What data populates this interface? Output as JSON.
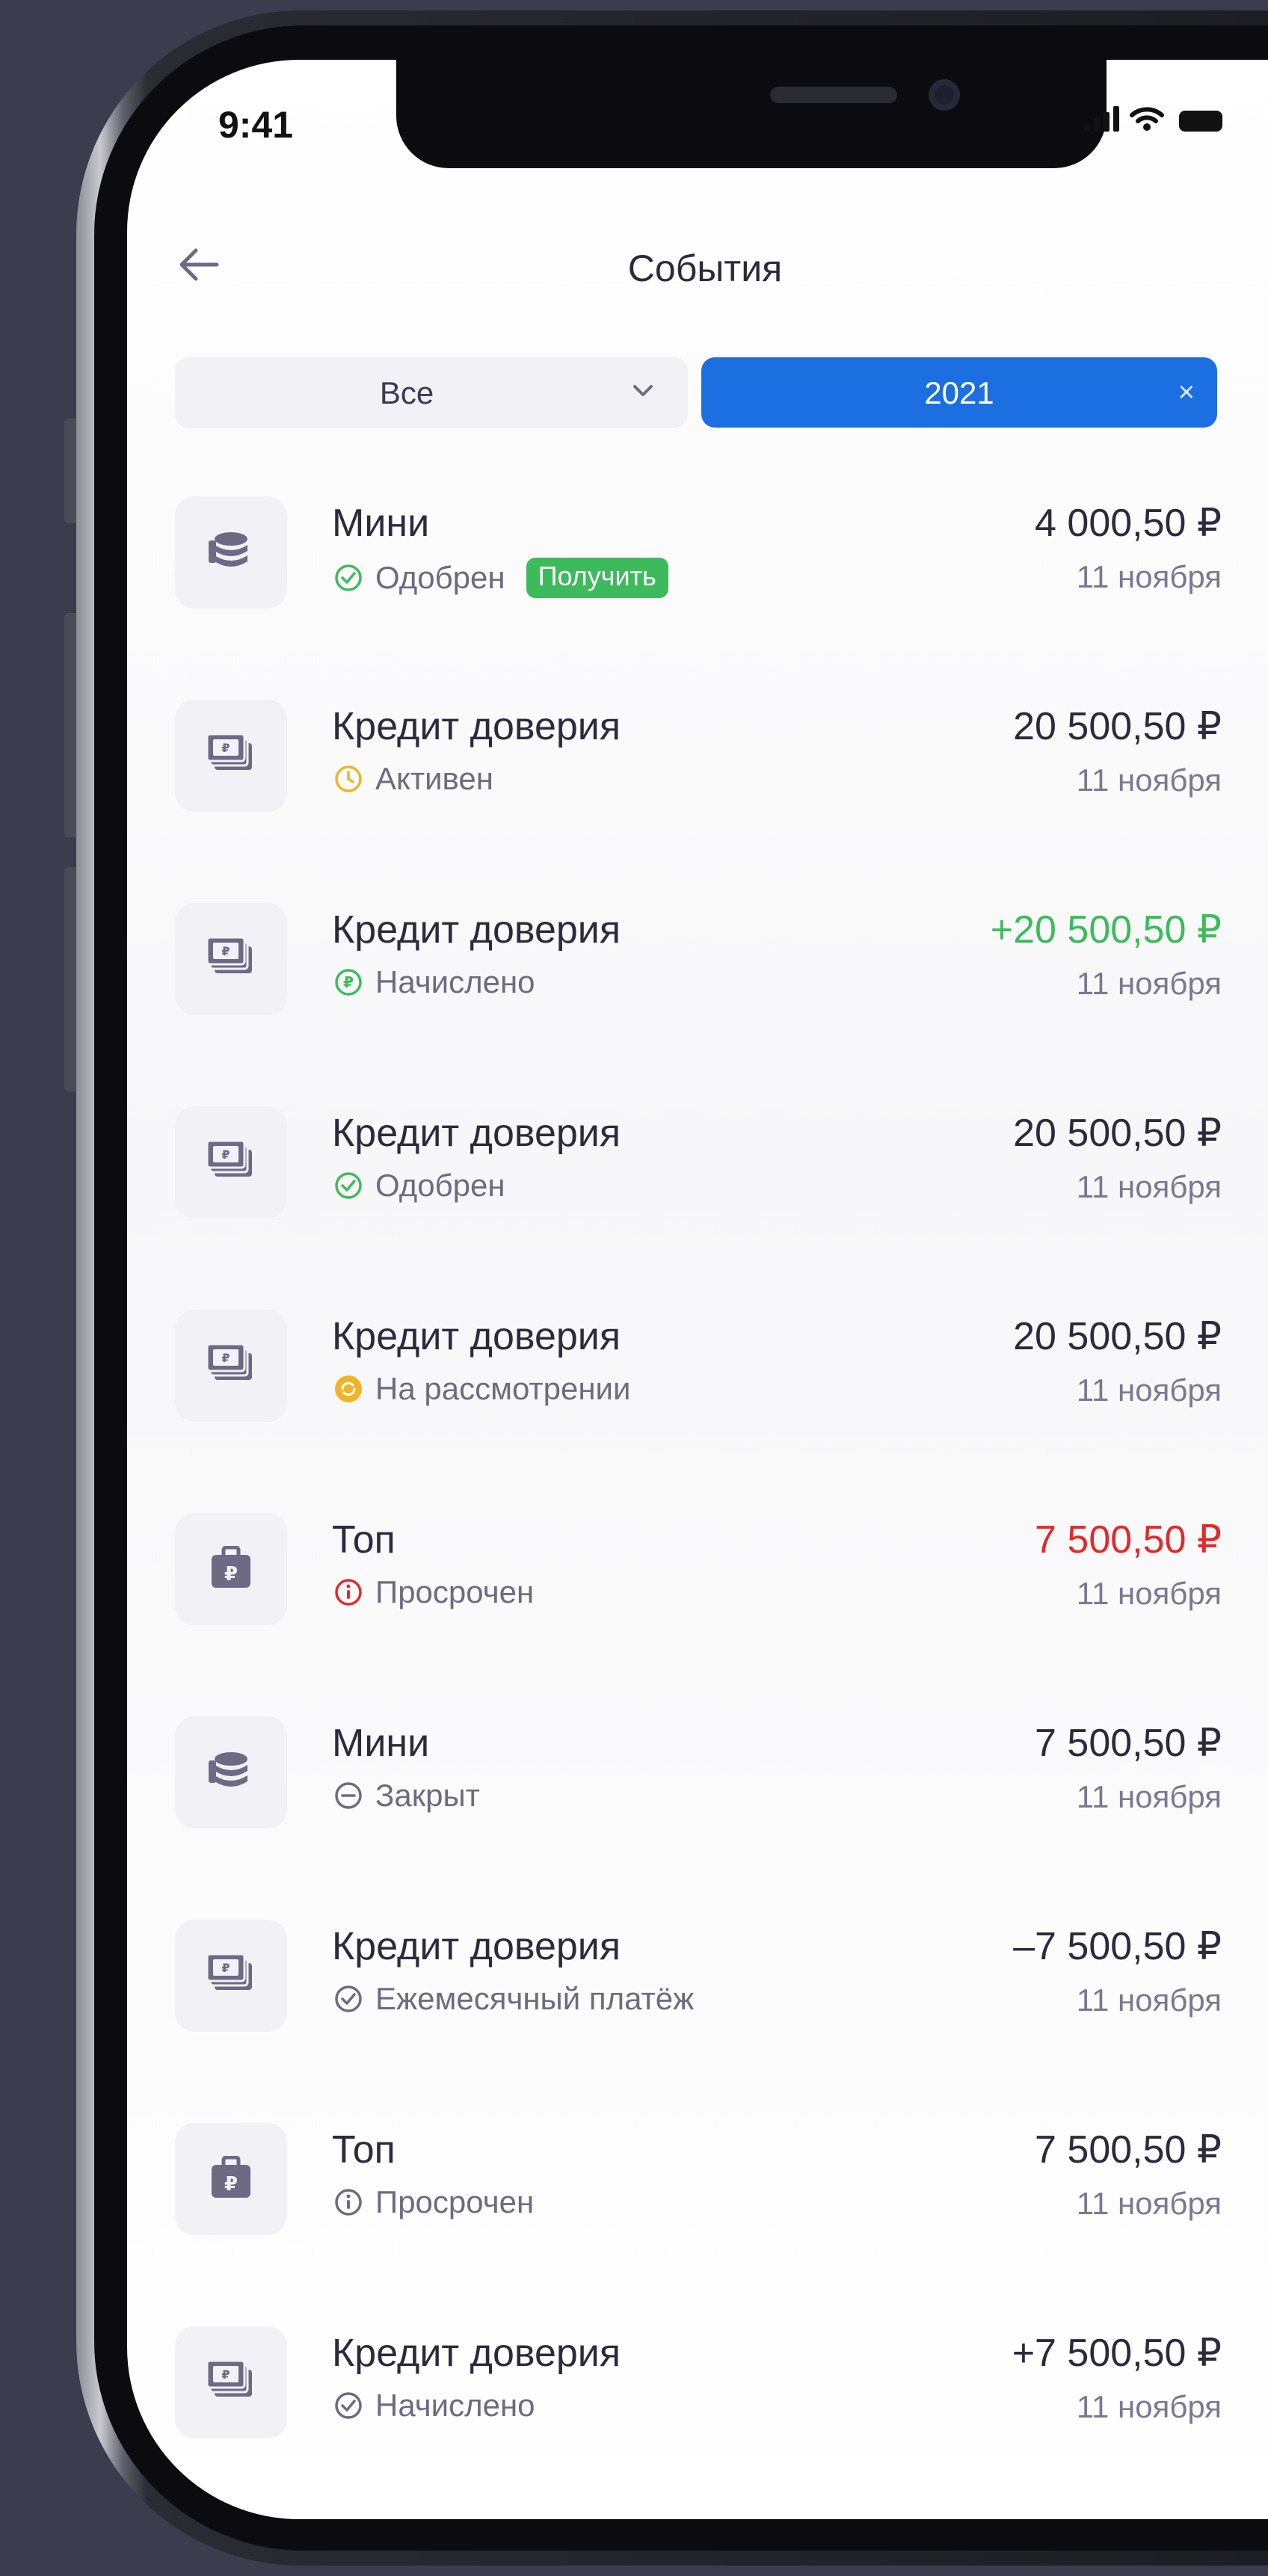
{
  "status_bar": {
    "time": "9:41"
  },
  "header": {
    "title": "События"
  },
  "filters": {
    "type_value": "Все",
    "year_value": "2021",
    "clear_glyph": "×"
  },
  "colors": {
    "accent": "#1c6fe0",
    "positive": "#3dbb5c",
    "negative": "#e02b2b",
    "text": "#2e2a3d",
    "muted": "#6f6a80",
    "icon_bg": "#f1f1f6",
    "icon_fg": "#6e6a85",
    "pending": "#f0b429"
  },
  "events": [
    {
      "icon": "coins-icon",
      "title": "Мини",
      "status": "Одобрен",
      "status_icon": "check-circle-icon",
      "status_color": "#3dbb5c",
      "badge": "Получить",
      "amount": "4 000,50 ₽",
      "amount_color": "#2e2a3d",
      "date": "11 ноября"
    },
    {
      "icon": "banknote-icon",
      "title": "Кредит доверия",
      "status": "Активен",
      "status_icon": "clock-icon",
      "status_color": "#f0b429",
      "badge": "",
      "amount": "20 500,50 ₽",
      "amount_color": "#2e2a3d",
      "date": "11 ноября"
    },
    {
      "icon": "banknote-icon",
      "title": "Кредит доверия",
      "status": "Начислено",
      "status_icon": "ruble-circle-icon",
      "status_color": "#3dbb5c",
      "badge": "",
      "amount": "+20 500,50 ₽",
      "amount_color": "#3dbb5c",
      "date": "11 ноября"
    },
    {
      "icon": "banknote-icon",
      "title": "Кредит доверия",
      "status": "Одобрен",
      "status_icon": "check-circle-icon",
      "status_color": "#3dbb5c",
      "badge": "",
      "amount": "20 500,50 ₽",
      "amount_color": "#2e2a3d",
      "date": "11 ноября"
    },
    {
      "icon": "banknote-icon",
      "title": "Кредит доверия",
      "status": "На рассмотрении",
      "status_icon": "refresh-circle-icon",
      "status_color": "#f0b429",
      "badge": "",
      "amount": "20 500,50 ₽",
      "amount_color": "#2e2a3d",
      "date": "11 ноября"
    },
    {
      "icon": "briefcase-icon",
      "title": "Топ",
      "status": "Просрочен",
      "status_icon": "info-circle-icon",
      "status_color": "#e02b2b",
      "badge": "",
      "amount": "7 500,50 ₽",
      "amount_color": "#e02b2b",
      "date": "11 ноября"
    },
    {
      "icon": "coins-icon",
      "title": "Мини",
      "status": "Закрыт",
      "status_icon": "minus-circle-icon",
      "status_color": "#6f6a80",
      "badge": "",
      "amount": "7 500,50 ₽",
      "amount_color": "#2e2a3d",
      "date": "11 ноября"
    },
    {
      "icon": "banknote-icon",
      "title": "Кредит доверия",
      "status": "Ежемесячный платёж",
      "status_icon": "check-circle-icon",
      "status_color": "#6f6a80",
      "badge": "",
      "amount": "–7 500,50 ₽",
      "amount_color": "#2e2a3d",
      "date": "11 ноября"
    },
    {
      "icon": "briefcase-icon",
      "title": "Топ",
      "status": "Просрочен",
      "status_icon": "info-circle-icon",
      "status_color": "#6f6a80",
      "badge": "",
      "amount": "7 500,50 ₽",
      "amount_color": "#2e2a3d",
      "date": "11 ноября"
    },
    {
      "icon": "banknote-icon",
      "title": "Кредит доверия",
      "status": "Начислено",
      "status_icon": "check-circle-icon",
      "status_color": "#6f6a80",
      "badge": "",
      "amount": "+7 500,50 ₽",
      "amount_color": "#2e2a3d",
      "date": "11 ноября"
    }
  ]
}
